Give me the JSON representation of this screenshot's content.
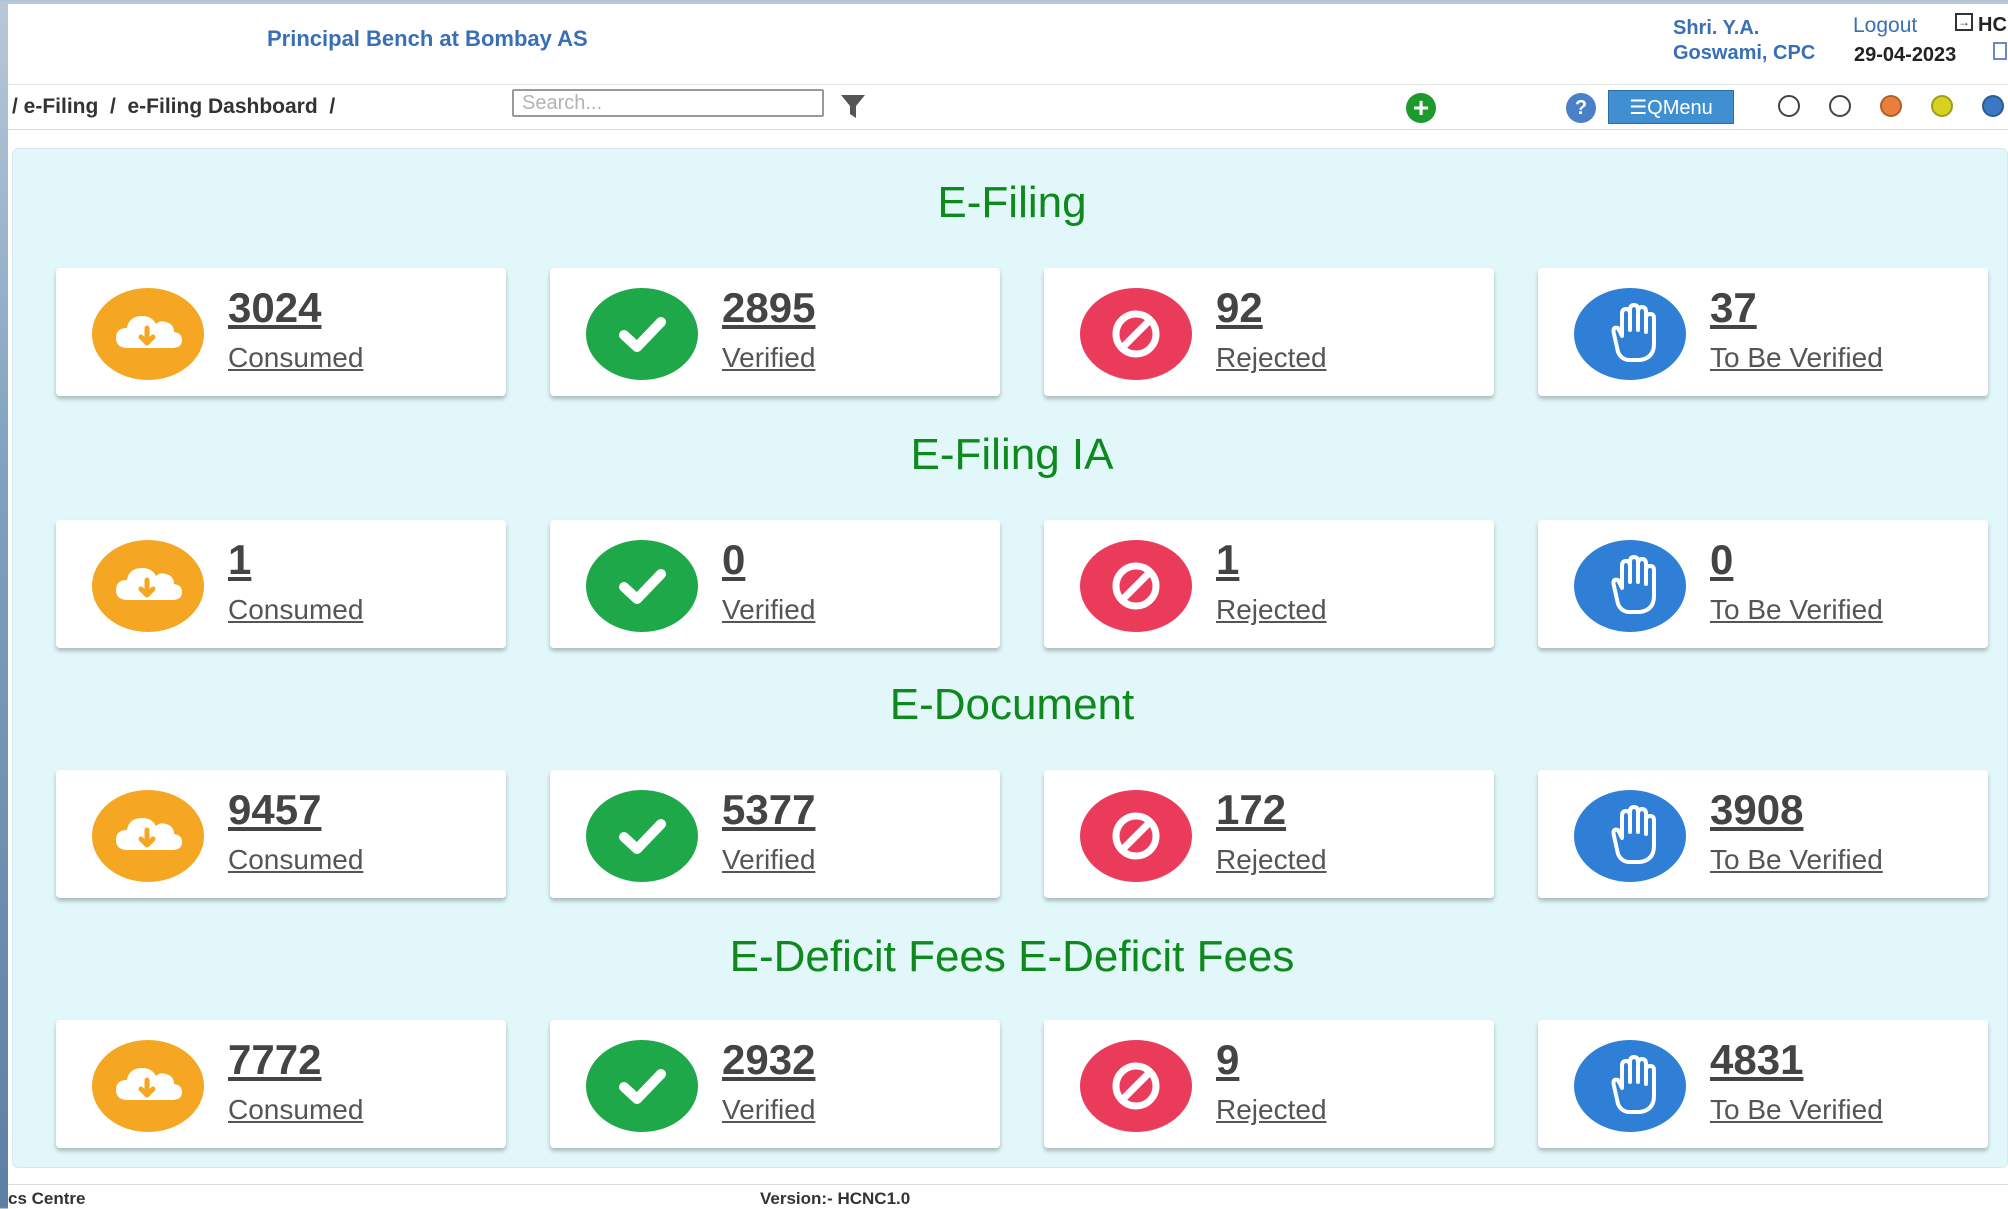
{
  "header": {
    "bench_title": "Principal Bench at Bombay AS",
    "user_line1": "Shri. Y.A.",
    "user_line2": "Goswami, CPC",
    "logout_label": "Logout",
    "court_code": "HC",
    "date": "29-04-2023"
  },
  "navbar": {
    "breadcrumb": "/ e-Filing  /  e-Filing Dashboard  /",
    "search_placeholder": "Search...",
    "qmenu_label": "QMenu",
    "theme_colors": [
      "#ffffff",
      "#ffffff",
      "#e97f3a",
      "#d6d21f",
      "#3b78c4"
    ]
  },
  "dashboard": {
    "sections": [
      {
        "title": "E-Filing",
        "cards": [
          {
            "value": "3024",
            "label": "Consumed",
            "icon": "cloud-download-icon",
            "color": "#f5a623"
          },
          {
            "value": "2895",
            "label": "Verified",
            "icon": "check-icon",
            "color": "#1fa84a"
          },
          {
            "value": "92",
            "label": "Rejected",
            "icon": "ban-icon",
            "color": "#eb3b5a"
          },
          {
            "value": "37",
            "label": "To Be Verified",
            "icon": "hand-icon",
            "color": "#2f7fd6"
          }
        ]
      },
      {
        "title": "E-Filing IA",
        "cards": [
          {
            "value": "1",
            "label": "Consumed",
            "icon": "cloud-download-icon",
            "color": "#f5a623"
          },
          {
            "value": "0",
            "label": "Verified",
            "icon": "check-icon",
            "color": "#1fa84a"
          },
          {
            "value": "1",
            "label": "Rejected",
            "icon": "ban-icon",
            "color": "#eb3b5a"
          },
          {
            "value": "0",
            "label": "To Be Verified",
            "icon": "hand-icon",
            "color": "#2f7fd6"
          }
        ]
      },
      {
        "title": "E-Document",
        "cards": [
          {
            "value": "9457",
            "label": "Consumed",
            "icon": "cloud-download-icon",
            "color": "#f5a623"
          },
          {
            "value": "5377",
            "label": "Verified",
            "icon": "check-icon",
            "color": "#1fa84a"
          },
          {
            "value": "172",
            "label": "Rejected",
            "icon": "ban-icon",
            "color": "#eb3b5a"
          },
          {
            "value": "3908",
            "label": "To Be Verified",
            "icon": "hand-icon",
            "color": "#2f7fd6"
          }
        ]
      },
      {
        "title": "E-Deficit Fees E-Deficit Fees",
        "cards": [
          {
            "value": "7772",
            "label": "Consumed",
            "icon": "cloud-download-icon",
            "color": "#f5a623"
          },
          {
            "value": "2932",
            "label": "Verified",
            "icon": "check-icon",
            "color": "#1fa84a"
          },
          {
            "value": "9",
            "label": "Rejected",
            "icon": "ban-icon",
            "color": "#eb3b5a"
          },
          {
            "value": "4831",
            "label": "To Be Verified",
            "icon": "hand-icon",
            "color": "#2f7fd6"
          }
        ]
      }
    ]
  },
  "footer": {
    "left_text": "cs Centre",
    "version": "Version:- HCNC1.0"
  }
}
